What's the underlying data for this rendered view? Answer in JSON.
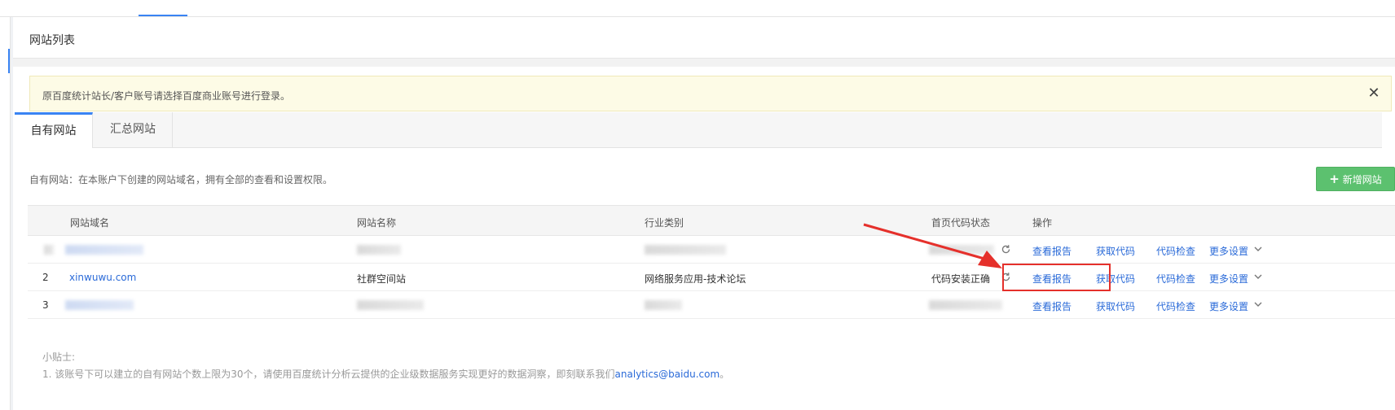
{
  "section": {
    "title": "网站列表"
  },
  "notice": {
    "text": "原百度统计站长/客户账号请选择百度商业账号进行登录。",
    "close_label": "✕"
  },
  "tabs": [
    {
      "label": "自有网站",
      "active": true
    },
    {
      "label": "汇总网站",
      "active": false
    }
  ],
  "description": "自有网站：在本账户下创建的网站域名，拥有全部的查看和设置权限。",
  "add_button": {
    "icon": "plus-icon",
    "label": "新增网站"
  },
  "table": {
    "headers": [
      "网站域名",
      "网站名称",
      "行业类别",
      "首页代码状态",
      "操作"
    ],
    "rows": [
      {
        "index": "",
        "domain": "",
        "name": "",
        "industry": "",
        "status": "",
        "blurred": true
      },
      {
        "index": "2",
        "domain": "xinwuwu.com",
        "name": "社群空间站",
        "industry": "网络服务应用-技术论坛",
        "status": "代码安装正确",
        "blurred": false
      },
      {
        "index": "3",
        "domain": "",
        "name": "",
        "industry": "",
        "status": "",
        "blurred": true
      }
    ],
    "actions": [
      "查看报告",
      "获取代码",
      "代码检查",
      "更多设置"
    ]
  },
  "tips": {
    "title": "小贴士:",
    "line1": "1. 该账号下可以建立的自有网站个数上限为30个，请使用百度统计分析云提供的企业级数据服务实现更好的数据洞察，即刻联系我们",
    "email": "analytics@baidu.com",
    "line1_end": "。"
  },
  "colors": {
    "accent": "#3a84f3",
    "link": "#2a6ad8",
    "add_button": "#5cc16f",
    "highlight": "#e5302b",
    "notice_bg": "#fdfbe6"
  }
}
